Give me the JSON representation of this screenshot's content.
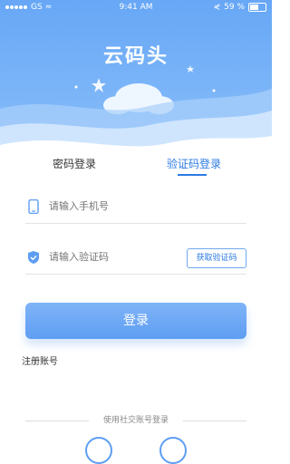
{
  "status": {
    "carrier": "GS",
    "time": "9:41 AM",
    "battery": "59 %"
  },
  "app": {
    "title": "云码头"
  },
  "tabs": [
    {
      "label": "密码登录"
    },
    {
      "label": "验证码登录"
    }
  ],
  "form": {
    "phone_placeholder": "请输入手机号",
    "code_placeholder": "请输入验证码",
    "get_code_label": "获取验证码",
    "login_label": "登录",
    "register_label": "注册账号"
  },
  "social": {
    "label": "使用社交账号登录"
  },
  "colors": {
    "accent": "#5e9ef2",
    "hero": "#67a7f6"
  }
}
